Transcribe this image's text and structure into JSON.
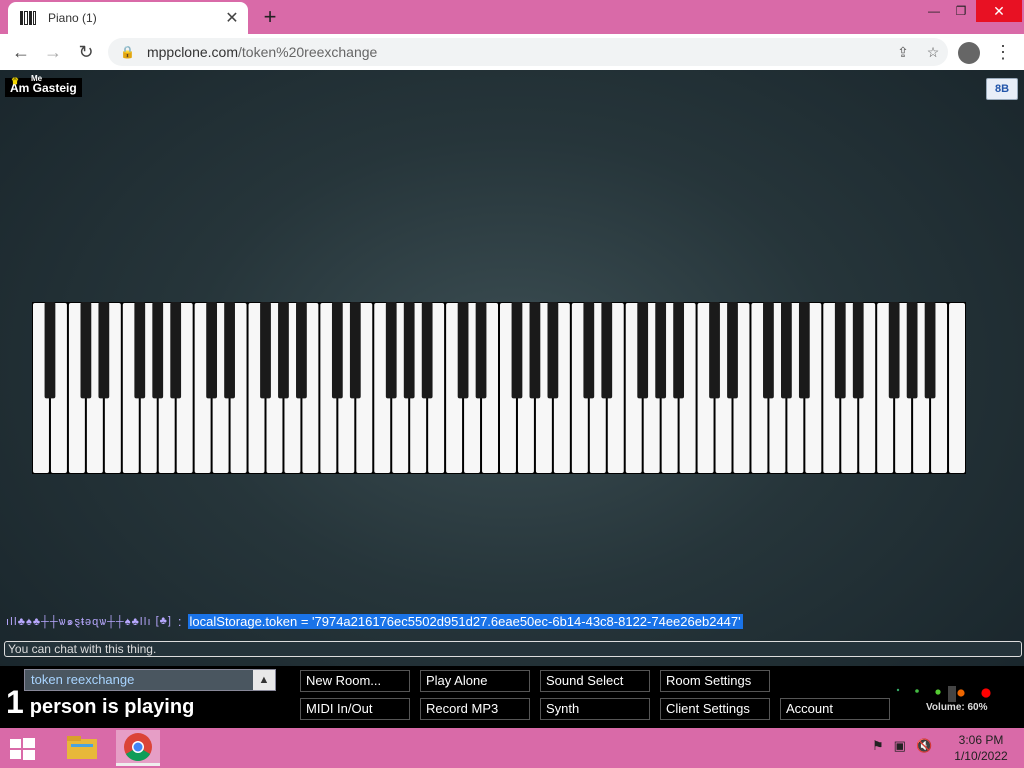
{
  "browser": {
    "tab_title": "Piano (1)",
    "tab_close": "✕",
    "new_tab": "+",
    "window_min": "—",
    "window_max": "❐",
    "window_close": "✕",
    "url_domain": "mppclone.com",
    "url_path": "/token%20reexchange"
  },
  "page": {
    "user_name": "Am Gasteig",
    "user_badge": "Me",
    "bb_label": "8B",
    "chat": {
      "name": "ıǀǀ♣♠♣┼┼ѡ๑ȿᵵǝɋѡ┼┼♠♣ǀǀı",
      "bracket": "[♣]",
      "colon": ":",
      "message": "localStorage.token = '7974a216176ec5502d951d27.6eae50ec-6b14-43c8-8122-74ee26eb2447'"
    },
    "chat_placeholder": "You can chat with this thing.",
    "room_name": "token reexchange",
    "people_count": "1",
    "people_text": "person is playing",
    "buttons": {
      "new_room": "New Room...",
      "play_alone": "Play Alone",
      "sound_select": "Sound Select",
      "room_settings": "Room Settings",
      "midi": "MIDI In/Out",
      "record": "Record MP3",
      "synth": "Synth",
      "client_settings": "Client Settings",
      "account": "Account"
    },
    "volume_label": "Volume: 60%",
    "volume_value": 60
  },
  "taskbar": {
    "time": "3:06 PM",
    "date": "1/10/2022"
  },
  "colors": {
    "tab_bar": "#d96aa8",
    "chat_highlight": "#1a73e8",
    "chat_name": "#b8a8ff"
  }
}
